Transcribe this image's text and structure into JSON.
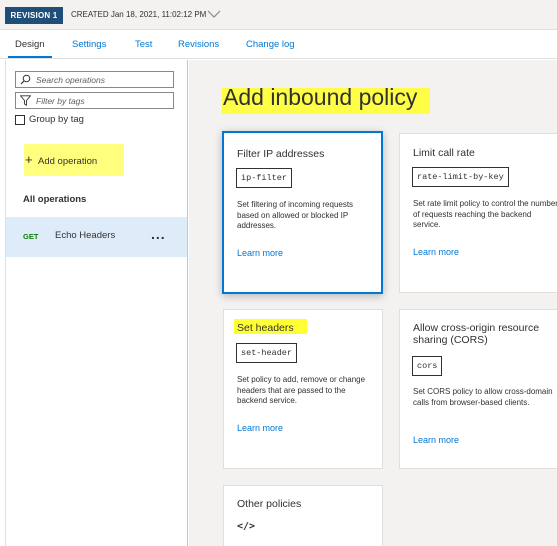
{
  "revision": {
    "badge": "REVISION 1",
    "created": "CREATED Jan 18, 2021, 11:02:12 PM"
  },
  "tabs": [
    {
      "label": "Design",
      "active": true
    },
    {
      "label": "Settings"
    },
    {
      "label": "Test"
    },
    {
      "label": "Revisions"
    },
    {
      "label": "Change log"
    }
  ],
  "sidebar": {
    "search_placeholder": "Search operations",
    "filter_placeholder": "Filter by tags",
    "group_by_tag": "Group by tag",
    "add_operation": "Add operation",
    "all_operations": "All operations",
    "operations": [
      {
        "method": "GET",
        "name": "Echo Headers",
        "more": "..."
      }
    ]
  },
  "main": {
    "title": "Add inbound policy",
    "cards": [
      {
        "title": "Filter IP addresses",
        "code": "ip-filter",
        "description": "Set filtering of incoming requests based on allowed or blocked IP addresses.",
        "learn_more": "Learn more"
      },
      {
        "title": "Limit call rate",
        "code": "rate-limit-by-key",
        "description": "Set rate limit policy to control the number of requests reaching the backend service.",
        "learn_more": "Learn more"
      },
      {
        "title": "Set headers",
        "code": "set-header",
        "description": "Set policy to add, remove or change headers that are passed to the backend service.",
        "learn_more": "Learn more"
      },
      {
        "title": "Allow cross-origin resource sharing (CORS)",
        "code": "cors",
        "description": "Set CORS policy to allow cross-domain calls from browser-based clients.",
        "learn_more": "Learn more"
      },
      {
        "title": "Other policies",
        "icon": "code-icon",
        "symbol": "</>"
      }
    ]
  },
  "colors": {
    "accent": "#0078d4",
    "revision_badge": "#1f4e79",
    "highlight": "#ffff33",
    "selected_row": "#deecf9",
    "get_method": "#107c10"
  }
}
